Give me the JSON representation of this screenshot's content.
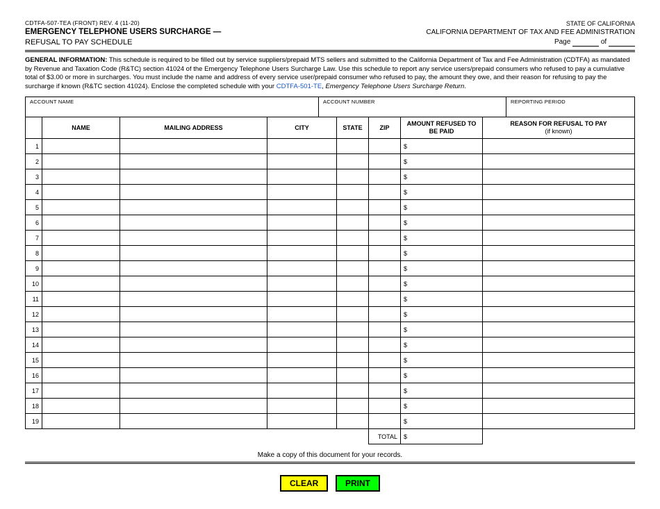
{
  "header": {
    "form_code": "CDTFA-507-TEA (FRONT) REV. 4 (11-20)",
    "title": "EMERGENCY TELEPHONE USERS SURCHARGE —",
    "subtitle": "REFUSAL TO PAY SCHEDULE",
    "state": "STATE OF CALIFORNIA",
    "dept": "CALIFORNIA DEPARTMENT OF TAX AND FEE ADMINISTRATION",
    "page_label_1": "Page",
    "page_label_2": "of"
  },
  "general_info": {
    "heading": "GENERAL INFORMATION:",
    "body_1": " This schedule is required to be filled out by service suppliers/prepaid MTS sellers and submitted to the California Department of Tax and Fee Administration (CDTFA) as mandated by Revenue and Taxation Code (R&TC) section 41024 of the Emergency Telephone Users Surcharge Law. Use this schedule to report any service users/prepaid consumers who refused to pay a cumulative total of $3.00 or more in surcharges. You must include the name and address of every service user/prepaid consumer who refused to pay, the amount they owe, and their reason for refusing to pay the surcharge if known (R&TC section 41024). Enclose the completed schedule with your ",
    "link_text": "CDTFA-501-TE",
    "body_2": ", Emergency Telephone Users Surcharge Return.",
    "italic_part": "Emergency Telephone Users Surcharge Return"
  },
  "account": {
    "name_label": "ACCOUNT NAME",
    "number_label": "ACCOUNT NUMBER",
    "period_label": "REPORTING PERIOD"
  },
  "columns": {
    "name": "NAME",
    "address": "MAILING ADDRESS",
    "city": "CITY",
    "state": "STATE",
    "zip": "ZIP",
    "amount": "AMOUNT REFUSED TO BE PAID",
    "reason": "REASON FOR REFUSAL TO PAY",
    "reason_sub": "(if known)"
  },
  "rows": [
    1,
    2,
    3,
    4,
    5,
    6,
    7,
    8,
    9,
    10,
    11,
    12,
    13,
    14,
    15,
    16,
    17,
    18,
    19
  ],
  "dollar_sign": "$",
  "total_label": "TOTAL",
  "footer_note": "Make a copy of this document for your records.",
  "buttons": {
    "clear": "CLEAR",
    "print": "PRINT"
  }
}
